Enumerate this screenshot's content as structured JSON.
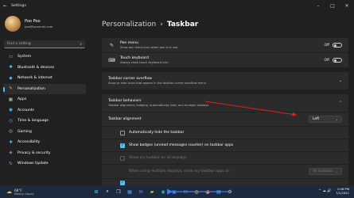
{
  "window": {
    "title": "Settings",
    "back_icon": "arrow-left-icon",
    "min": "–",
    "max": "□",
    "close": "✕"
  },
  "profile": {
    "name": "Poo Poo",
    "email": "poo@poomail.com"
  },
  "search": {
    "placeholder": "Find a setting"
  },
  "sidebar": {
    "items": [
      {
        "label": "System",
        "icon": "monitor-icon",
        "color": "#4cc2ff",
        "glyph": "▭"
      },
      {
        "label": "Bluetooth & devices",
        "icon": "bluetooth-icon",
        "color": "#4cc2ff",
        "glyph": "✱"
      },
      {
        "label": "Network & internet",
        "icon": "wifi-icon",
        "color": "#4cc2ff",
        "glyph": "◆"
      },
      {
        "label": "Personalization",
        "icon": "brush-icon",
        "color": "#f0a050",
        "glyph": "✎",
        "active": true
      },
      {
        "label": "Apps",
        "icon": "apps-icon",
        "color": "#c8c8c8",
        "glyph": "▦"
      },
      {
        "label": "Accounts",
        "icon": "person-icon",
        "color": "#2ea8e0",
        "glyph": "●"
      },
      {
        "label": "Time & language",
        "icon": "globe-clock-icon",
        "color": "#4cc2ff",
        "glyph": "◷"
      },
      {
        "label": "Gaming",
        "icon": "controller-icon",
        "color": "#c8c8c8",
        "glyph": "◎"
      },
      {
        "label": "Accessibility",
        "icon": "accessibility-icon",
        "color": "#4cc2ff",
        "glyph": "✚"
      },
      {
        "label": "Privacy & security",
        "icon": "shield-icon",
        "color": "#9a9a9a",
        "glyph": "◈"
      },
      {
        "label": "Windows Update",
        "icon": "update-icon",
        "color": "#4cc2ff",
        "glyph": "↻"
      }
    ]
  },
  "breadcrumb": {
    "parent": "Personalization",
    "separator": "›",
    "current": "Taskbar"
  },
  "pen_menu": {
    "title": "Pen menu",
    "subtitle": "Show pen menu icon when pen is in use",
    "state": "Off"
  },
  "touch_keyboard": {
    "title": "Touch keyboard",
    "subtitle": "Always show touch keyboard icon",
    "state": "Off"
  },
  "corner_overflow": {
    "title": "Taskbar corner overflow",
    "subtitle": "Show or hide icons that appear in the taskbar corner overflow menu"
  },
  "behaviors": {
    "title": "Taskbar behaviors",
    "subtitle": "Taskbar alignment, badging, automatically hide, and multiple displays",
    "alignment_label": "Taskbar alignment",
    "alignment_value": "Left",
    "auto_hide": "Automatically hide the taskbar",
    "badges": "Show badges (unread messages counter) on taskbar apps",
    "all_displays": "Show my taskbar on all displays",
    "multi_display_label": "When using multiple displays, show my taskbar apps on",
    "multi_display_value": "All taskbars"
  },
  "taskbar": {
    "weather_temp": "68°F",
    "weather_desc": "Mostly cloudy",
    "apps": [
      "windows-logo-icon",
      "search-icon",
      "task-view-icon",
      "widgets-icon",
      "chat-icon",
      "explorer-icon",
      "edge-icon",
      "store-icon",
      "mail-icon",
      "chrome-icon",
      "firefox-icon",
      "photos-icon",
      "settings-icon"
    ],
    "tray": "^ ☁ 🔊",
    "time": "1:08 PM",
    "date": "7/1/2021"
  },
  "colors": {
    "accent": "#4cc2ff",
    "annotation_arrow": "#e02020"
  }
}
